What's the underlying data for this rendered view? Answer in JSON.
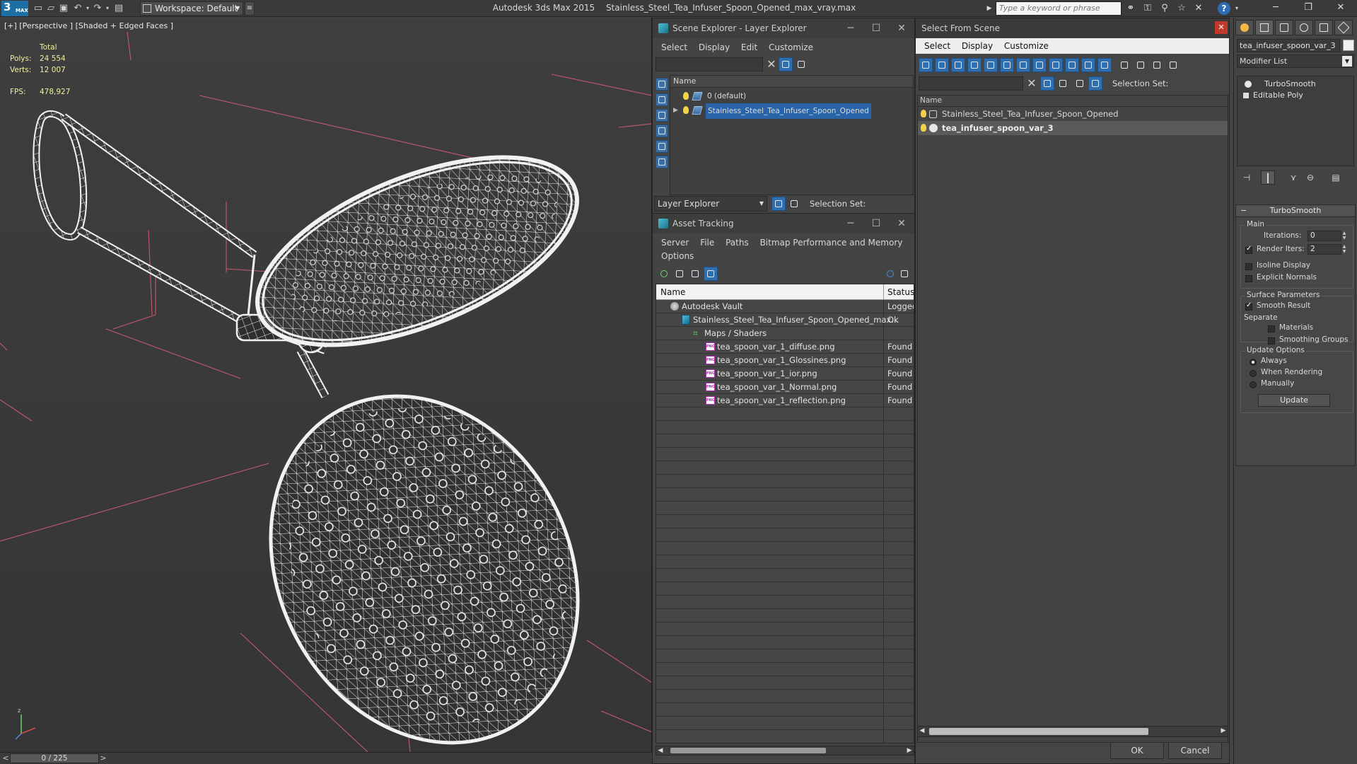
{
  "titlebar": {
    "logo_main": "3",
    "logo_sub": "MAX",
    "workspace_label": "Workspace: Default",
    "app_name": "Autodesk 3ds Max  2015",
    "file_name": "Stainless_Steel_Tea_Infuser_Spoon_Opened_max_vray.max",
    "search_placeholder": "Type a keyword or phrase",
    "help_label": "?"
  },
  "viewport": {
    "label": "[+] [Perspective ] [Shaded + Edged Faces ]",
    "stats": {
      "total_label": "Total",
      "polys_label": "Polys:",
      "polys_value": "24 554",
      "verts_label": "Verts:",
      "verts_value": "12 007",
      "fps_label": "FPS:",
      "fps_value": "478,927"
    },
    "timeline": "0 / 225"
  },
  "scene_explorer": {
    "title": "Scene Explorer - Layer Explorer",
    "menu": [
      "Select",
      "Display",
      "Edit",
      "Customize"
    ],
    "column_name": "Name",
    "layers": [
      {
        "name": "0 (default)",
        "selected": false
      },
      {
        "name": "Stainless_Steel_Tea_Infuser_Spoon_Opened",
        "selected": true
      }
    ],
    "explorer_dropdown": "Layer Explorer",
    "selection_set_label": "Selection Set:"
  },
  "asset_tracking": {
    "title": "Asset Tracking",
    "menu": [
      "Server",
      "File",
      "Paths",
      "Bitmap Performance and Memory"
    ],
    "menu_row2": [
      "Options"
    ],
    "col_name": "Name",
    "col_status": "Status",
    "rows": [
      {
        "name": "Autodesk Vault",
        "status": "Logged",
        "indent": 0,
        "icon": "vault"
      },
      {
        "name": "Stainless_Steel_Tea_Infuser_Spoon_Opened_max...",
        "status": "Ok",
        "indent": 1,
        "icon": "file"
      },
      {
        "name": "Maps / Shaders",
        "status": "",
        "indent": 2,
        "icon": "maps"
      },
      {
        "name": "tea_spoon_var_1_diffuse.png",
        "status": "Found",
        "indent": 3,
        "icon": "png"
      },
      {
        "name": "tea_spoon_var_1_Glossines.png",
        "status": "Found",
        "indent": 3,
        "icon": "png"
      },
      {
        "name": "tea_spoon_var_1_ior.png",
        "status": "Found",
        "indent": 3,
        "icon": "png"
      },
      {
        "name": "tea_spoon_var_1_Normal.png",
        "status": "Found",
        "indent": 3,
        "icon": "png"
      },
      {
        "name": "tea_spoon_var_1_reflection.png",
        "status": "Found",
        "indent": 3,
        "icon": "png"
      }
    ],
    "png_tag": "PNG"
  },
  "select_from_scene": {
    "title": "Select From Scene",
    "menu": [
      "Select",
      "Display",
      "Customize"
    ],
    "selection_set_label": "Selection Set:",
    "column_name": "Name",
    "objects": [
      {
        "name": "Stainless_Steel_Tea_Infuser_Spoon_Opened",
        "selected": false
      },
      {
        "name": "tea_infuser_spoon_var_3",
        "selected": true
      }
    ],
    "ok_label": "OK",
    "cancel_label": "Cancel"
  },
  "command_panel": {
    "object_name": "tea_infuser_spoon_var_3",
    "modifier_list": "Modifier List",
    "stack": [
      "TurboSmooth",
      "Editable Poly"
    ],
    "rollout_title": "TurboSmooth",
    "main_group": "Main",
    "iterations_label": "Iterations:",
    "iterations_value": "0",
    "render_iters_label": "Render Iters:",
    "render_iters_value": "2",
    "render_iters_checked": true,
    "isoline_label": "Isoline Display",
    "explicit_normals_label": "Explicit Normals",
    "surface_group": "Surface Parameters",
    "smooth_result_label": "Smooth Result",
    "separate_label": "Separate",
    "materials_label": "Materials",
    "smoothing_groups_label": "Smoothing Groups",
    "update_group": "Update Options",
    "always_label": "Always",
    "when_rendering_label": "When Rendering",
    "manually_label": "Manually",
    "update_button": "Update"
  },
  "colors": {
    "selection_blue": "#2a64a8",
    "stats_yellow": "#f0f0a0",
    "grid_red": "#c45a6e",
    "wire_white": "#f0f0f0"
  }
}
